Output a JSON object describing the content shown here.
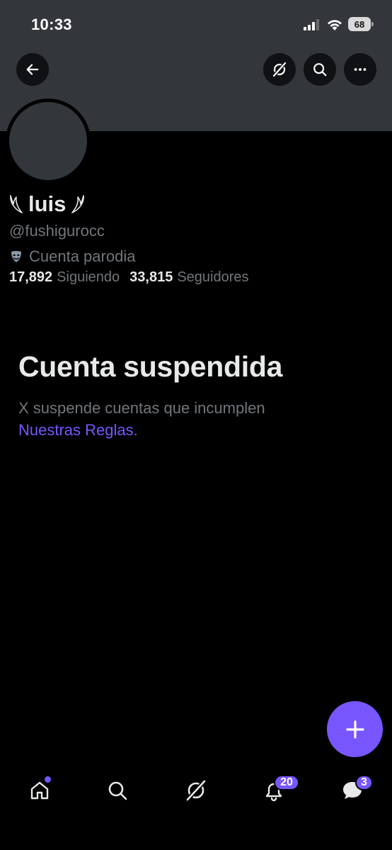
{
  "status_bar": {
    "time": "10:33",
    "battery_level": "68"
  },
  "header": {
    "back_icon": "arrow-left-icon",
    "grok_icon": "grok-icon",
    "search_icon": "search-icon",
    "more_icon": "more-horizontal-icon"
  },
  "profile": {
    "display_name": "luis",
    "handle": "@fushigurocc",
    "parody_label": "Cuenta parodia",
    "following_count": "17,892",
    "following_label": "Siguiendo",
    "followers_count": "33,815",
    "followers_label": "Seguidores"
  },
  "suspension": {
    "title": "Cuenta suspendida",
    "message": "X suspende cuentas que incumplen",
    "rules_link": "Nuestras Reglas",
    "trailing_period": "."
  },
  "compose": {
    "icon": "plus-icon"
  },
  "bottom_nav": {
    "items": [
      {
        "name": "home",
        "icon": "home-icon"
      },
      {
        "name": "search",
        "icon": "search-icon"
      },
      {
        "name": "grok",
        "icon": "grok-icon"
      },
      {
        "name": "notifications",
        "icon": "bell-icon",
        "badge": "20"
      },
      {
        "name": "messages",
        "icon": "chat-icon",
        "badge": "3"
      }
    ]
  },
  "colors": {
    "accent": "#7856ff",
    "background": "#000000",
    "banner": "#33363a",
    "secondary_text": "#71767b",
    "primary_text": "#e7e9ea"
  }
}
